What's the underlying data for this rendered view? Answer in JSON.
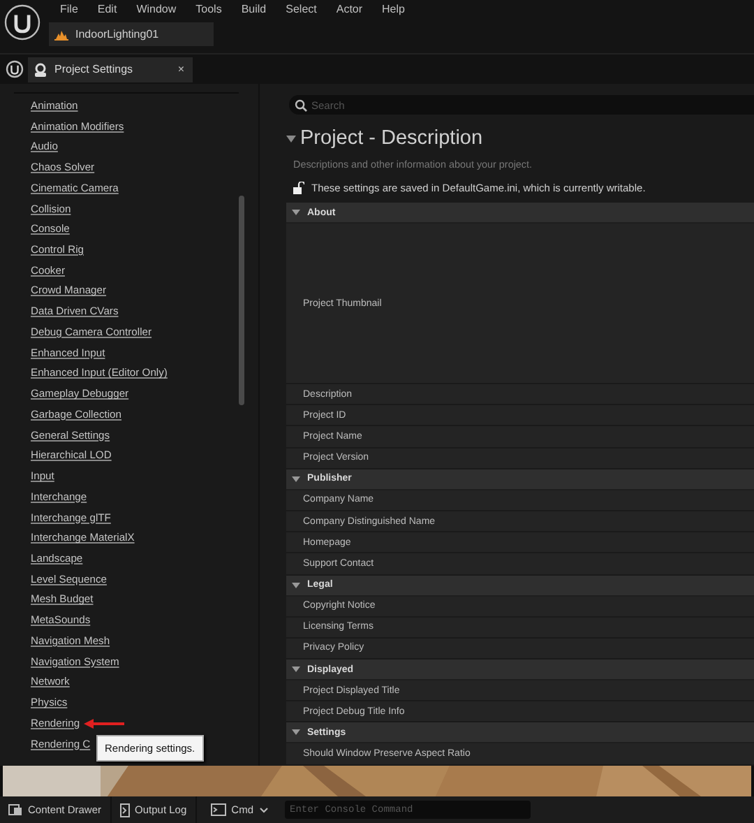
{
  "menu_bar": {
    "items": [
      "File",
      "Edit",
      "Window",
      "Tools",
      "Build",
      "Select",
      "Actor",
      "Help"
    ]
  },
  "level_tab": {
    "label": "IndoorLighting01"
  },
  "panel_tab": {
    "label": "Project Settings",
    "close": "×"
  },
  "sidebar": {
    "items": [
      {
        "label": "Animation"
      },
      {
        "label": "Animation Modifiers"
      },
      {
        "label": "Audio"
      },
      {
        "label": "Chaos Solver"
      },
      {
        "label": "Cinematic Camera"
      },
      {
        "label": "Collision"
      },
      {
        "label": "Console"
      },
      {
        "label": "Control Rig"
      },
      {
        "label": "Cooker"
      },
      {
        "label": "Crowd Manager"
      },
      {
        "label": "Data Driven CVars"
      },
      {
        "label": "Debug Camera Controller"
      },
      {
        "label": "Enhanced Input"
      },
      {
        "label": "Enhanced Input (Editor Only)"
      },
      {
        "label": "Gameplay Debugger"
      },
      {
        "label": "Garbage Collection"
      },
      {
        "label": "General Settings"
      },
      {
        "label": "Hierarchical LOD"
      },
      {
        "label": "Input"
      },
      {
        "label": "Interchange"
      },
      {
        "label": "Interchange glTF"
      },
      {
        "label": "Interchange MaterialX"
      },
      {
        "label": "Landscape"
      },
      {
        "label": "Level Sequence"
      },
      {
        "label": "Mesh Budget"
      },
      {
        "label": "MetaSounds"
      },
      {
        "label": "Navigation Mesh"
      },
      {
        "label": "Navigation System"
      },
      {
        "label": "Network"
      },
      {
        "label": "Physics"
      },
      {
        "label": "Rendering",
        "tooltip": "Rendering settings."
      },
      {
        "label": "Rendering C"
      }
    ]
  },
  "search": {
    "placeholder": "Search"
  },
  "page": {
    "title": "Project - Description",
    "subtitle": "Descriptions and other information about your project.",
    "notice": "These settings are saved in DefaultGame.ini, which is currently writable."
  },
  "sections": [
    {
      "title": "About",
      "expanded": true,
      "rows": [
        {
          "label": "Project Thumbnail",
          "kind": "thumbnail"
        },
        {
          "label": "Description",
          "kind": "text"
        },
        {
          "label": "Project ID",
          "kind": "text"
        },
        {
          "label": "Project Name",
          "kind": "text"
        },
        {
          "label": "Project Version",
          "kind": "text"
        }
      ]
    },
    {
      "title": "Publisher",
      "expanded": true,
      "rows": [
        {
          "label": "Company Name",
          "kind": "text"
        },
        {
          "label": "Company Distinguished Name",
          "kind": "text"
        },
        {
          "label": "Homepage",
          "kind": "text"
        },
        {
          "label": "Support Contact",
          "kind": "text"
        }
      ]
    },
    {
      "title": "Legal",
      "expanded": true,
      "rows": [
        {
          "label": "Copyright Notice",
          "kind": "text"
        },
        {
          "label": "Licensing Terms",
          "kind": "text"
        },
        {
          "label": "Privacy Policy",
          "kind": "text"
        }
      ]
    },
    {
      "title": "Displayed",
      "expanded": true,
      "rows": [
        {
          "label": "Project Displayed Title",
          "kind": "text"
        },
        {
          "label": "Project Debug Title Info",
          "kind": "text"
        }
      ]
    },
    {
      "title": "Settings",
      "expanded": true,
      "rows": [
        {
          "label": "Should Window Preserve Aspect Ratio",
          "kind": "text"
        }
      ]
    }
  ],
  "status_bar": {
    "content_drawer": "Content Drawer",
    "output_log": "Output Log",
    "cmd": "Cmd",
    "console_placeholder": "Enter Console Command"
  }
}
